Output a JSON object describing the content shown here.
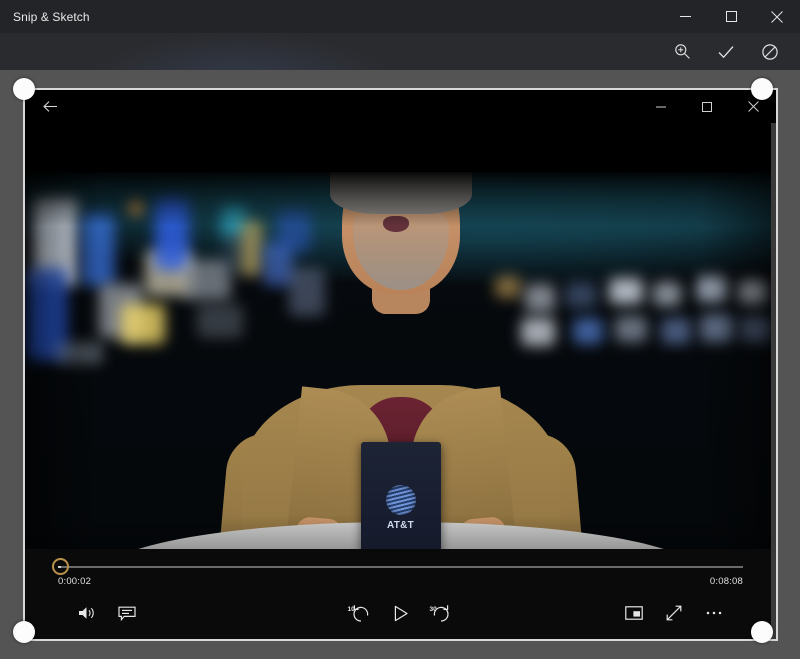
{
  "app": {
    "title": "Snip & Sketch",
    "window_buttons": [
      {
        "name": "minimize",
        "glyph": "minimize-icon"
      },
      {
        "name": "maximize",
        "glyph": "maximize-icon"
      },
      {
        "name": "close",
        "glyph": "close-icon"
      }
    ],
    "toolbar": [
      {
        "name": "zoom",
        "label": "Zoom",
        "glyph": "magnifier-plus-icon"
      },
      {
        "name": "accept",
        "label": "Accept",
        "glyph": "checkmark-icon"
      },
      {
        "name": "cancel",
        "label": "Cancel",
        "glyph": "no-entry-icon"
      }
    ]
  },
  "snip": {
    "backdrop_color": "#545454",
    "border_color": "#d8d8d8",
    "handles": [
      "top-left",
      "top-right",
      "bottom-left",
      "bottom-right"
    ]
  },
  "player": {
    "back_label": "Back",
    "window_buttons": [
      {
        "name": "minimize",
        "glyph": "minimize-icon"
      },
      {
        "name": "maximize",
        "glyph": "maximize-icon"
      },
      {
        "name": "close",
        "glyph": "close-icon"
      }
    ],
    "scrubber": {
      "current_time": "0:00:02",
      "duration": "0:08:08",
      "progress_percent": 0.4,
      "thumb_color": "#b8924a",
      "track_color": "#6b6b6b"
    },
    "controls_left": [
      {
        "name": "volume",
        "label": "Volume",
        "glyph": "speaker-icon"
      },
      {
        "name": "closed-captions",
        "label": "Closed captions",
        "glyph": "captions-icon"
      }
    ],
    "controls_center": [
      {
        "name": "rewind-10",
        "label": "Rewind 10 seconds",
        "glyph": "rewind-icon",
        "seconds": "10"
      },
      {
        "name": "play",
        "label": "Play",
        "glyph": "play-icon",
        "seconds": ""
      },
      {
        "name": "forward-30",
        "label": "Forward 30 seconds",
        "glyph": "forward-icon",
        "seconds": "30"
      }
    ],
    "controls_right": [
      {
        "name": "mini-player",
        "label": "Mini player",
        "glyph": "mini-player-icon"
      },
      {
        "name": "full-screen",
        "label": "Full screen",
        "glyph": "expand-arrows-icon"
      },
      {
        "name": "more-options",
        "label": "More options",
        "glyph": "ellipsis-icon"
      }
    ]
  },
  "video": {
    "scene_description": "Man in tan jacket holding a phone box at a desk in front of a wall of screens",
    "brand": {
      "name": "AT&T",
      "logo": "att-globe-icon",
      "box_color": "#1d2435"
    },
    "backdrop": {
      "ceiling_color": "#2d7f92",
      "base_color": "#060a0e"
    },
    "desk_color": "#cfd0cf",
    "jacket_color": "#a6874f",
    "shirt_color": "#6b2332",
    "hair_color": "#c9c6c2"
  }
}
